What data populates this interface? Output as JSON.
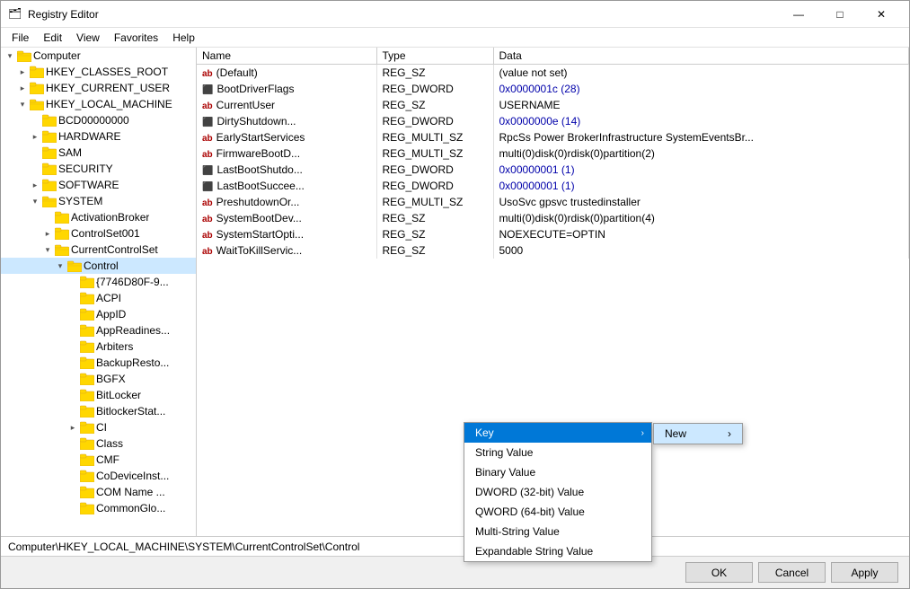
{
  "window": {
    "title": "Registry Editor",
    "icon": "🗂"
  },
  "titlebar": {
    "minimize": "—",
    "maximize": "□",
    "close": "✕"
  },
  "menu": {
    "items": [
      "File",
      "Edit",
      "View",
      "Favorites",
      "Help"
    ]
  },
  "tree": {
    "items": [
      {
        "id": "computer",
        "label": "Computer",
        "indent": 0,
        "expanded": true,
        "hasToggle": true,
        "toggleOpen": true
      },
      {
        "id": "hkcr",
        "label": "HKEY_CLASSES_ROOT",
        "indent": 1,
        "expanded": false,
        "hasToggle": true,
        "toggleOpen": false
      },
      {
        "id": "hkcu",
        "label": "HKEY_CURRENT_USER",
        "indent": 1,
        "expanded": false,
        "hasToggle": true,
        "toggleOpen": false
      },
      {
        "id": "hklm",
        "label": "HKEY_LOCAL_MACHINE",
        "indent": 1,
        "expanded": true,
        "hasToggle": true,
        "toggleOpen": true
      },
      {
        "id": "bcd",
        "label": "BCD00000000",
        "indent": 2,
        "expanded": false,
        "hasToggle": false
      },
      {
        "id": "hardware",
        "label": "HARDWARE",
        "indent": 2,
        "expanded": false,
        "hasToggle": true,
        "toggleOpen": false
      },
      {
        "id": "sam",
        "label": "SAM",
        "indent": 2,
        "expanded": false,
        "hasToggle": false
      },
      {
        "id": "security",
        "label": "SECURITY",
        "indent": 2,
        "expanded": false,
        "hasToggle": false
      },
      {
        "id": "software",
        "label": "SOFTWARE",
        "indent": 2,
        "expanded": false,
        "hasToggle": true,
        "toggleOpen": false
      },
      {
        "id": "system",
        "label": "SYSTEM",
        "indent": 2,
        "expanded": true,
        "hasToggle": true,
        "toggleOpen": true
      },
      {
        "id": "actbroker",
        "label": "ActivationBroker",
        "indent": 3,
        "expanded": false,
        "hasToggle": false
      },
      {
        "id": "ctrlset001",
        "label": "ControlSet001",
        "indent": 3,
        "expanded": false,
        "hasToggle": true,
        "toggleOpen": false
      },
      {
        "id": "curctrlset",
        "label": "CurrentControlSet",
        "indent": 3,
        "expanded": true,
        "hasToggle": true,
        "toggleOpen": true
      },
      {
        "id": "control",
        "label": "Control",
        "indent": 4,
        "expanded": true,
        "hasToggle": true,
        "toggleOpen": true,
        "selected": true
      },
      {
        "id": "key7746",
        "label": "{7746D80F-9...",
        "indent": 5,
        "expanded": false,
        "hasToggle": false
      },
      {
        "id": "acpi",
        "label": "ACPI",
        "indent": 5,
        "expanded": false,
        "hasToggle": false
      },
      {
        "id": "appid",
        "label": "AppID",
        "indent": 5,
        "expanded": false,
        "hasToggle": false
      },
      {
        "id": "appreadiness",
        "label": "AppReadines...",
        "indent": 5,
        "expanded": false,
        "hasToggle": false
      },
      {
        "id": "arbiters",
        "label": "Arbiters",
        "indent": 5,
        "expanded": false,
        "hasToggle": false
      },
      {
        "id": "backuprestore",
        "label": "BackupResto...",
        "indent": 5,
        "expanded": false,
        "hasToggle": false
      },
      {
        "id": "bgfx",
        "label": "BGFX",
        "indent": 5,
        "expanded": false,
        "hasToggle": false
      },
      {
        "id": "bitlocker",
        "label": "BitLocker",
        "indent": 5,
        "expanded": false,
        "hasToggle": false
      },
      {
        "id": "bitlockerstatus",
        "label": "BitlockerStat...",
        "indent": 5,
        "expanded": false,
        "hasToggle": false
      },
      {
        "id": "ci",
        "label": "CI",
        "indent": 5,
        "expanded": false,
        "hasToggle": true,
        "toggleOpen": false
      },
      {
        "id": "class",
        "label": "Class",
        "indent": 5,
        "expanded": false,
        "hasToggle": false
      },
      {
        "id": "cmf",
        "label": "CMF",
        "indent": 5,
        "expanded": false,
        "hasToggle": false
      },
      {
        "id": "codeviceinst",
        "label": "CoDeviceInst...",
        "indent": 5,
        "expanded": false,
        "hasToggle": false
      },
      {
        "id": "comname",
        "label": "COM Name ...",
        "indent": 5,
        "expanded": false,
        "hasToggle": false
      },
      {
        "id": "commonglo",
        "label": "CommonGlo...",
        "indent": 5,
        "expanded": false,
        "hasToggle": false
      }
    ]
  },
  "table": {
    "columns": [
      "Name",
      "Type",
      "Data"
    ],
    "rows": [
      {
        "name": "(Default)",
        "type": "REG_SZ",
        "data": "(value not set)",
        "icon": "ab"
      },
      {
        "name": "BootDriverFlags",
        "type": "REG_DWORD",
        "data": "0x0000001c (28)",
        "icon": "bb"
      },
      {
        "name": "CurrentUser",
        "type": "REG_SZ",
        "data": "USERNAME",
        "icon": "ab"
      },
      {
        "name": "DirtyShutdown...",
        "type": "REG_DWORD",
        "data": "0x0000000e (14)",
        "icon": "bb"
      },
      {
        "name": "EarlyStartServices",
        "type": "REG_MULTI_SZ",
        "data": "RpcSs Power BrokerInfrastructure SystemEventsBr...",
        "icon": "ab"
      },
      {
        "name": "FirmwareBootD...",
        "type": "REG_MULTI_SZ",
        "data": "multi(0)disk(0)rdisk(0)partition(2)",
        "icon": "ab"
      },
      {
        "name": "LastBootShutdo...",
        "type": "REG_DWORD",
        "data": "0x00000001 (1)",
        "icon": "bb"
      },
      {
        "name": "LastBootSuccee...",
        "type": "REG_DWORD",
        "data": "0x00000001 (1)",
        "icon": "bb"
      },
      {
        "name": "PreshutdownOr...",
        "type": "REG_MULTI_SZ",
        "data": "UsoSvc gpsvc trustedinstaller",
        "icon": "ab"
      },
      {
        "name": "SystemBootDev...",
        "type": "REG_SZ",
        "data": "multi(0)disk(0)rdisk(0)partition(4)",
        "icon": "ab"
      },
      {
        "name": "SystemStartOpti...",
        "type": "REG_SZ",
        "data": "NOEXECUTE=OPTIN",
        "icon": "ab"
      },
      {
        "name": "WaitToKillServic...",
        "type": "REG_SZ",
        "data": "5000",
        "icon": "ab"
      }
    ]
  },
  "contextMenu": {
    "items": [
      {
        "label": "Key",
        "hasSubmenu": true,
        "highlighted": true
      },
      {
        "label": "String Value",
        "hasSubmenu": false
      },
      {
        "label": "Binary Value",
        "hasSubmenu": false
      },
      {
        "label": "DWORD (32-bit) Value",
        "hasSubmenu": false
      },
      {
        "label": "QWORD (64-bit) Value",
        "hasSubmenu": false
      },
      {
        "label": "Multi-String Value",
        "hasSubmenu": false
      },
      {
        "label": "Expandable String Value",
        "hasSubmenu": false
      }
    ],
    "submenu": {
      "label": "New",
      "arrow": "›"
    }
  },
  "statusBar": {
    "path": "Computer\\HKEY_LOCAL_MACHINE\\SYSTEM\\CurrentControlSet\\Control"
  },
  "buttons": {
    "ok": "OK",
    "cancel": "Cancel",
    "apply": "Apply"
  }
}
